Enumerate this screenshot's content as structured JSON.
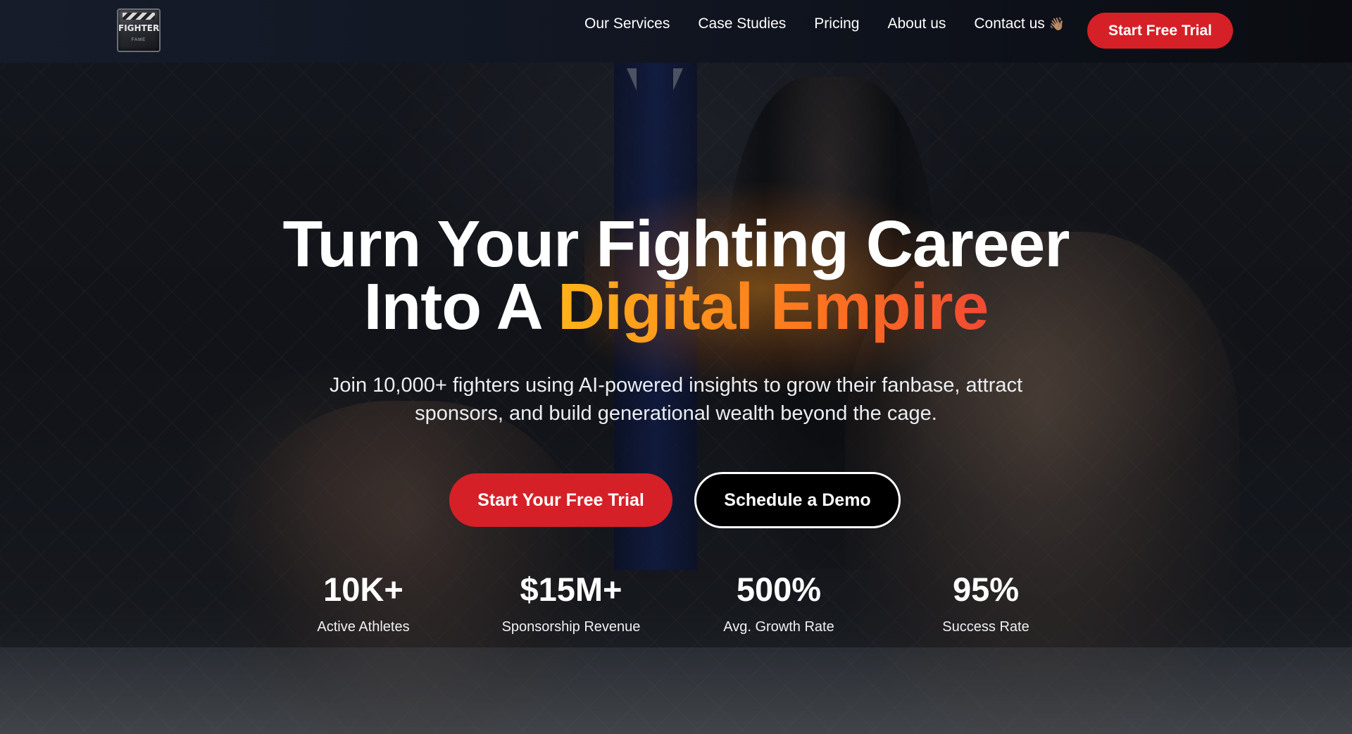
{
  "nav": {
    "logo_text": "FIGHTER",
    "logo_subtext": "FAME",
    "links": [
      "Our Services",
      "Case Studies",
      "Pricing",
      "About us",
      "Contact us"
    ],
    "contact_icon": "waving-hand-icon",
    "contact_emoji": "👋🏽",
    "cta_label": "Start Free Trial"
  },
  "hero": {
    "headline_line1": "Turn Your Fighting Career",
    "headline_line2_prefix": "Into A ",
    "headline_line2_accent": "Digital Empire",
    "subheadline": "Join 10,000+ fighters using AI-powered insights to grow their fanbase, attract sponsors, and build generational wealth beyond the cage.",
    "primary_cta": "Start Your Free Trial",
    "secondary_cta": "Schedule a Demo",
    "background_image": "mma-fight-in-octagon"
  },
  "stats": [
    {
      "value": "10K+",
      "label": "Active Athletes"
    },
    {
      "value": "$15M+",
      "label": "Sponsorship Revenue"
    },
    {
      "value": "500%",
      "label": "Avg. Growth Rate"
    },
    {
      "value": "95%",
      "label": "Success Rate"
    }
  ],
  "colors": {
    "brand_red": "#d62027",
    "accent_gradient_start": "#ffb319",
    "accent_gradient_end": "#f04a34",
    "nav_background": "#111622"
  }
}
